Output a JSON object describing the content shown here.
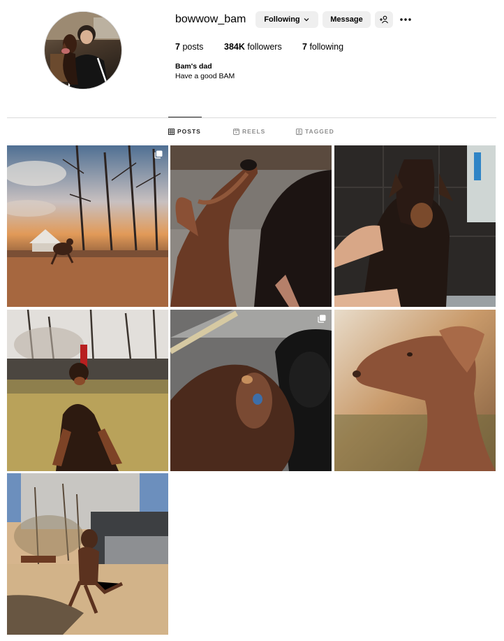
{
  "profile": {
    "username": "bowwow_bam",
    "following_button": "Following",
    "message_button": "Message",
    "posts_count": "7",
    "posts_label": "posts",
    "followers_count": "384K",
    "followers_label": "followers",
    "following_count": "7",
    "following_label": "following",
    "full_name": "Bam's dad",
    "bio": "Have a good BAM"
  },
  "tabs": [
    {
      "label": "POSTS",
      "icon": "grid-icon",
      "active": true
    },
    {
      "label": "REELS",
      "icon": "reels-icon",
      "active": false
    },
    {
      "label": "TAGGED",
      "icon": "tagged-icon",
      "active": false
    }
  ],
  "posts": [
    {
      "subject": "doberman-running-at-sunset-park",
      "carousel": true
    },
    {
      "subject": "doberman-looking-up",
      "carousel": false
    },
    {
      "subject": "doberman-wet-bath",
      "carousel": false
    },
    {
      "subject": "doberman-lying-on-grass",
      "carousel": false
    },
    {
      "subject": "doberman-closeup-blurry",
      "carousel": true
    },
    {
      "subject": "doberman-side-profile",
      "carousel": false
    },
    {
      "subject": "doberman-running-toward-camera",
      "carousel": false
    }
  ],
  "colors": {
    "button_bg": "#efefef",
    "divider": "#dbdbdb",
    "tab_inactive": "#8e8e8e",
    "tab_active": "#262626"
  }
}
